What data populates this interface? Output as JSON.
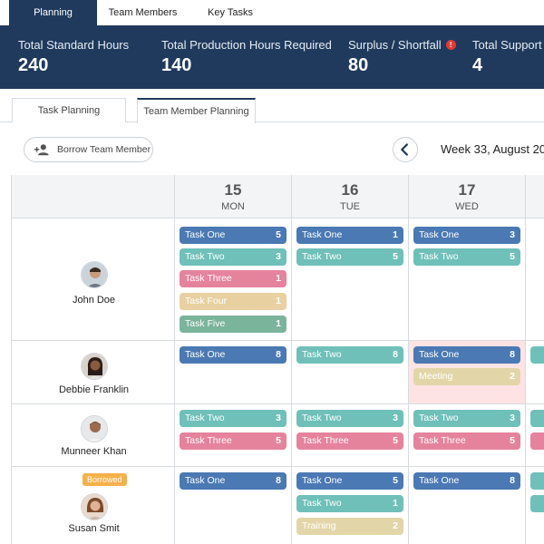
{
  "top_tabs": [
    "Planning",
    "Team Members",
    "Key Tasks"
  ],
  "stats": [
    {
      "label": "Total Standard Hours",
      "value": "240"
    },
    {
      "label": "Total Production Hours Required",
      "value": "140"
    },
    {
      "label": "Surplus / Shortfall",
      "value": "80",
      "info_icon": "info-icon"
    },
    {
      "label": "Total Support H",
      "value": "4"
    }
  ],
  "sub_tabs": [
    "Task Planning",
    "Team Member Planning"
  ],
  "toolbar": {
    "borrow_label": "Borrow Team Member",
    "borrow_icon": "add-person-icon",
    "prev_icon": "chevron-left-icon",
    "week_label": "Week 33, August 20"
  },
  "days": [
    {
      "num": "15",
      "name": "MON"
    },
    {
      "num": "16",
      "name": "TUE"
    },
    {
      "num": "17",
      "name": "WED"
    }
  ],
  "members": [
    {
      "name": "John Doe",
      "borrowed": "",
      "tasks": [
        [
          {
            "label": "Task One",
            "hours": "5",
            "color": "#4a79b3"
          },
          {
            "label": "Task Two",
            "hours": "3",
            "color": "#6ec0b9"
          },
          {
            "label": "Task Three",
            "hours": "1",
            "color": "#e5829c"
          },
          {
            "label": "Task Four",
            "hours": "1",
            "color": "#e8d0a0"
          },
          {
            "label": "Task Five",
            "hours": "1",
            "color": "#7ab49a"
          }
        ],
        [
          {
            "label": "Task One",
            "hours": "1",
            "color": "#4a79b3"
          },
          {
            "label": "Task Two",
            "hours": "5",
            "color": "#6ec0b9"
          }
        ],
        [
          {
            "label": "Task One",
            "hours": "3",
            "color": "#4a79b3"
          },
          {
            "label": "Task Two",
            "hours": "5",
            "color": "#6ec0b9"
          }
        ]
      ]
    },
    {
      "name": "Debbie Franklin",
      "borrowed": "",
      "tasks": [
        [
          {
            "label": "Task One",
            "hours": "8",
            "color": "#4a79b3"
          }
        ],
        [
          {
            "label": "Task Two",
            "hours": "8",
            "color": "#6ec0b9"
          }
        ],
        [
          {
            "label": "Task One",
            "hours": "8",
            "color": "#4a79b3"
          },
          {
            "label": "Meeting",
            "hours": "2",
            "color": "#e2d6a8"
          }
        ]
      ]
    },
    {
      "name": "Munneer Khan",
      "borrowed": "",
      "tasks": [
        [
          {
            "label": "Task Two",
            "hours": "3",
            "color": "#6ec0b9"
          },
          {
            "label": "Task Three",
            "hours": "5",
            "color": "#e5829c"
          }
        ],
        [
          {
            "label": "Task Two",
            "hours": "3",
            "color": "#6ec0b9"
          },
          {
            "label": "Task Three",
            "hours": "5",
            "color": "#e5829c"
          }
        ],
        [
          {
            "label": "Task Two",
            "hours": "3",
            "color": "#6ec0b9"
          },
          {
            "label": "Task Three",
            "hours": "5",
            "color": "#e5829c"
          }
        ]
      ]
    },
    {
      "name": "Susan Smit",
      "borrowed": "Borrowed",
      "tasks": [
        [
          {
            "label": "Task One",
            "hours": "8",
            "color": "#4a79b3"
          }
        ],
        [
          {
            "label": "Task One",
            "hours": "5",
            "color": "#4a79b3"
          },
          {
            "label": "Task Two",
            "hours": "1",
            "color": "#6ec0b9"
          },
          {
            "label": "Training",
            "hours": "2",
            "color": "#e2d6a8"
          }
        ],
        [
          {
            "label": "Task One",
            "hours": "8",
            "color": "#4a79b3"
          }
        ]
      ]
    }
  ],
  "colors": {
    "header_bg": "#1f3a5c",
    "highlight_cell": "#fde3e3",
    "borrowed_badge": "#f5b14a"
  }
}
